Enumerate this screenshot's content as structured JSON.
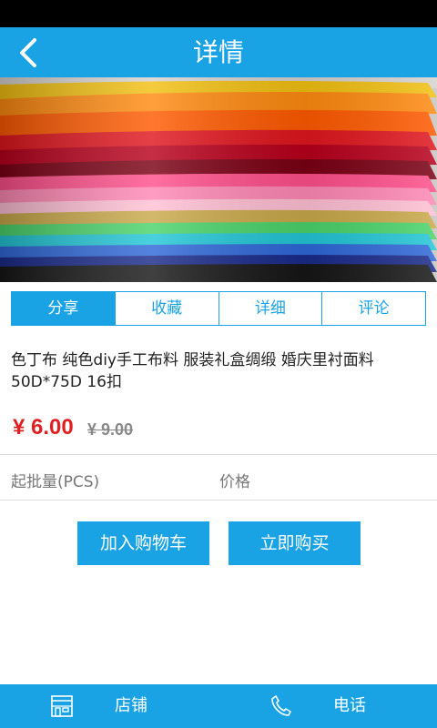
{
  "header": {
    "title": "详情"
  },
  "tabs": [
    {
      "label": "分享"
    },
    {
      "label": "收藏"
    },
    {
      "label": "详细"
    },
    {
      "label": "评论"
    }
  ],
  "product": {
    "title": "色丁布 纯色diy手工布料 服装礼盒绸缎 婚庆里衬面料50D*75D 16扣",
    "price": "¥ 6.00",
    "old_price": "¥ 9.00",
    "spec_qty_label": "起批量(PCS)",
    "spec_price_label": "价格"
  },
  "actions": {
    "add_to_cart": "加入购物车",
    "buy_now": "立即购买"
  },
  "bottombar": {
    "store_label": "店铺",
    "phone_label": "电话"
  },
  "colors": {
    "accent": "#1aa3e4",
    "price": "#e02020"
  },
  "icons": {
    "back": "chevron-left-icon",
    "store": "store-icon",
    "phone": "phone-icon"
  }
}
